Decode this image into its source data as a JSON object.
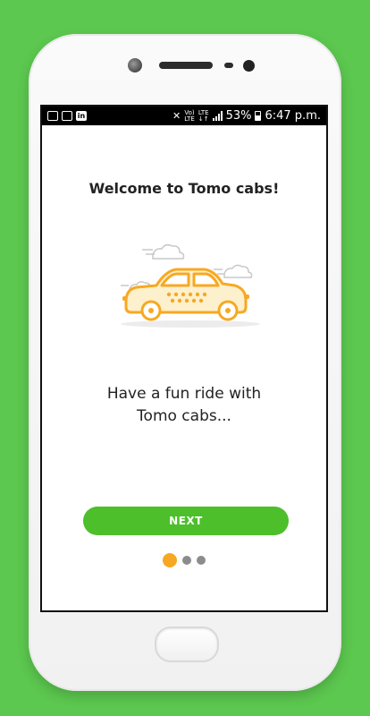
{
  "status_bar": {
    "battery": "53%",
    "time": "6:47 p.m.",
    "volte": "Vo) LTE",
    "lte": "LTE",
    "notification_icons": [
      "alert-icon",
      "image-icon",
      "linkedin-icon"
    ]
  },
  "onboarding": {
    "title": "Welcome to Tomo cabs!",
    "tagline_line1": "Have a fun ride with",
    "tagline_line2": "Tomo cabs...",
    "next_label": "NEXT",
    "page_count": 3,
    "active_page": 1
  },
  "colors": {
    "background": "#5cc84f",
    "button": "#4cbf2a",
    "accent": "#f7a823",
    "dot_inactive": "#8c8c8c"
  }
}
